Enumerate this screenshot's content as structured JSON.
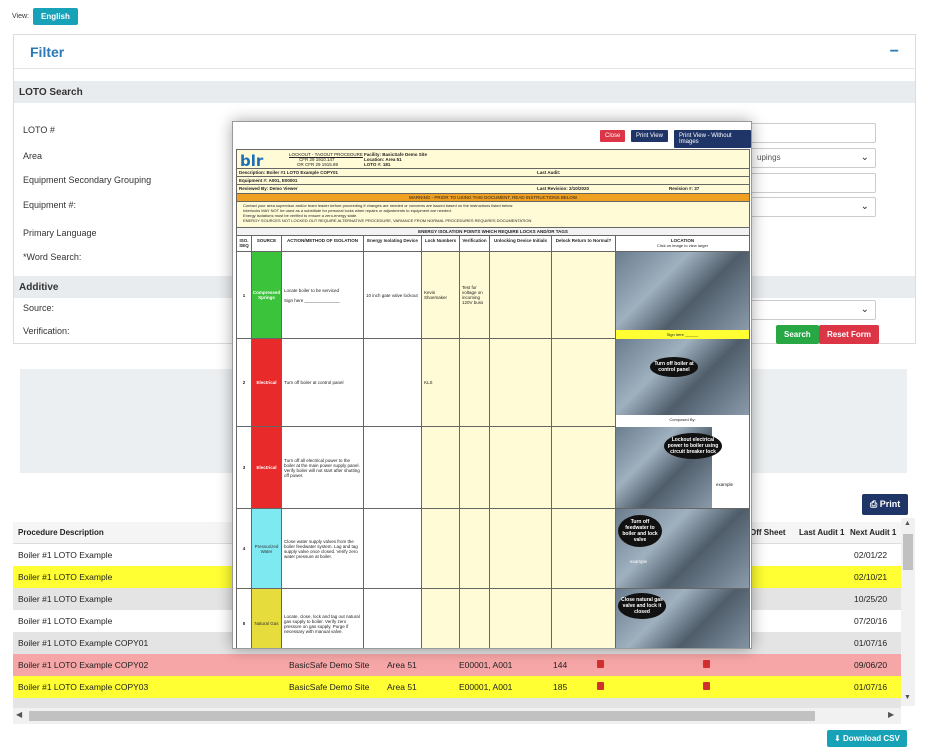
{
  "view": {
    "label": "View:",
    "language": "English"
  },
  "filter": {
    "title": "Filter",
    "collapse_symbol": "−",
    "loto_search_title": "LOTO Search",
    "fields": {
      "loto_num": "LOTO #",
      "area": "Area",
      "equipment_secondary_grouping": "Equipment Secondary Grouping",
      "equipment_num": "Equipment #:",
      "primary_language": "Primary Language",
      "word_search": "*Word Search:"
    },
    "groupings_partial": "upings",
    "additive_title": "Additive",
    "additive_fields": {
      "source": "Source:",
      "verification": "Verification:"
    },
    "search_label": "Search",
    "reset_label": "Reset Form"
  },
  "print_label": "Print",
  "download_csv_label": "Download CSV",
  "table": {
    "headers": {
      "procedure_description": "Procedure Description",
      "off_sheet": "Off Sheet",
      "last_audit": "Last Audit 1",
      "next_audit": "Next Audit 1"
    },
    "rows": [
      {
        "desc": "Boiler #1 LOTO Example",
        "next": "02/01/22",
        "style": "white"
      },
      {
        "desc": "Boiler #1 LOTO Example",
        "next": "02/10/21",
        "style": "yellow"
      },
      {
        "desc": "Boiler #1 LOTO Example",
        "next": "10/25/20",
        "style": "gray"
      },
      {
        "desc": "Boiler #1 LOTO Example",
        "next": "07/20/16",
        "style": "white"
      },
      {
        "desc": "Boiler #1 LOTO Example COPY01",
        "next": "01/07/16",
        "style": "gray"
      },
      {
        "desc": "Boiler #1 LOTO Example COPY02",
        "facility": "BasicSafe Demo Site",
        "area": "Area 51",
        "equipment": "E00001, A001",
        "num": "144",
        "next": "09/06/20",
        "style": "pink"
      },
      {
        "desc": "Boiler #1 LOTO Example COPY03",
        "facility": "BasicSafe Demo Site",
        "area": "Area 51",
        "equipment": "E00001, A001",
        "num": "185",
        "next": "01/07/16",
        "style": "yellow"
      }
    ]
  },
  "modal": {
    "close_label": "Close",
    "print_view_label": "Print View",
    "print_view_no_images_label": "Print View - Without Images",
    "doc": {
      "logo": "blr",
      "heading": "LOCKOUT - TAGOUT PROCEDURE",
      "cfr1": "CFR 29 1910.147",
      "cfr2": "OR CFR 29 1915.89",
      "facility": "Facility: BasicSafe Demo Site",
      "location": "Location: Area 51",
      "loto_num": "LOTO #: 181",
      "description": "Description: Boiler #1 LOTO Example COPY01",
      "last_audit": "Last Audit:",
      "equipment": "Equipment #: A001, E00001",
      "reviewed_by": "Reviewed By: Demo Viewer",
      "last_revision": "Last Revision: 2/10/2020",
      "revision": "Revision #: 37",
      "warning": "WARNING - PRIOR TO USING THIS DOCUMENT, READ INSTRUCTIONS BELOW",
      "notes": [
        "Contact your area supervisor and/or team leader before proceeding if changes are needed or concerns are issued based on the instructions listed below.",
        "Interlocks MAY NOT be used as a substitute for personal locks when repairs or adjustments to equipment are needed.",
        "Energy isolations must be verified to ensure a zero-energy state.",
        "ENERGY SOURCES NOT LOCKED OUT REQUIRE ALTERNATIVE PROCEDURE, VARIANCE FROM NORMAL PROCEDURES REQUIRES DOCUMENTATION"
      ],
      "isolation_title": "ENERGY ISOLATION POINTS WHICH REQUIRE LOCKS AND/OR TAGS",
      "columns": {
        "seq": "ISO. SEQ",
        "source": "SOURCE",
        "action": "ACTION/METHOD OF ISOLATION",
        "device": "Energy Isolating Device",
        "locks": "Lock Numbers",
        "verification": "Verification",
        "unlocking": "Unlocking Device Initials",
        "delock": "Delock Return to Normal?",
        "location": "LOCATION",
        "location_sub": "Click on image to view larger"
      },
      "steps": [
        {
          "seq": "1",
          "source": "Compressed Springs",
          "color": "#3cc33c",
          "action": "Locate boiler to be serviced",
          "sign": "Sign here ______________",
          "device": "10 inch gate valve lockout",
          "locks": "Kevin Shoemaker",
          "verify": "Test for voltage on incoming 120V buss",
          "photo_label": "Sign here ______"
        },
        {
          "seq": "2",
          "source": "Electrical",
          "color": "#e82a2a",
          "action": "Turn off boiler at control panel",
          "locks": "KLS",
          "callout": "Turn off boiler at control panel",
          "photo_label": "Composed By:"
        },
        {
          "seq": "3",
          "source": "Electrical",
          "color": "#e82a2a",
          "action": "Turn off all electrical power to the boiler at the main power supply panel. Verify boiler will not start after shutting off power.",
          "callout": "Lockout electrical power to boiler using circuit breaker lock",
          "extra": "example"
        },
        {
          "seq": "4",
          "source": "Pressurized Water",
          "color": "#7fe9f2",
          "action": "Close water supply valves from the boiler feedwater system. Lag and tag supply valve once closed. Verify zero water pressure at boiler.",
          "callout": "Turn off feedwater to boiler and lock valve",
          "extra": "example"
        },
        {
          "seq": "5",
          "source": "Natural Gas",
          "color": "#e6dc3c",
          "action": "Locate, close, lock and tag out natural gas supply to boiler. Verify zero pressure on gas supply. Purge if necessary with manual valve.",
          "callout": "Close natural gas valve and lock it closed"
        }
      ]
    }
  }
}
